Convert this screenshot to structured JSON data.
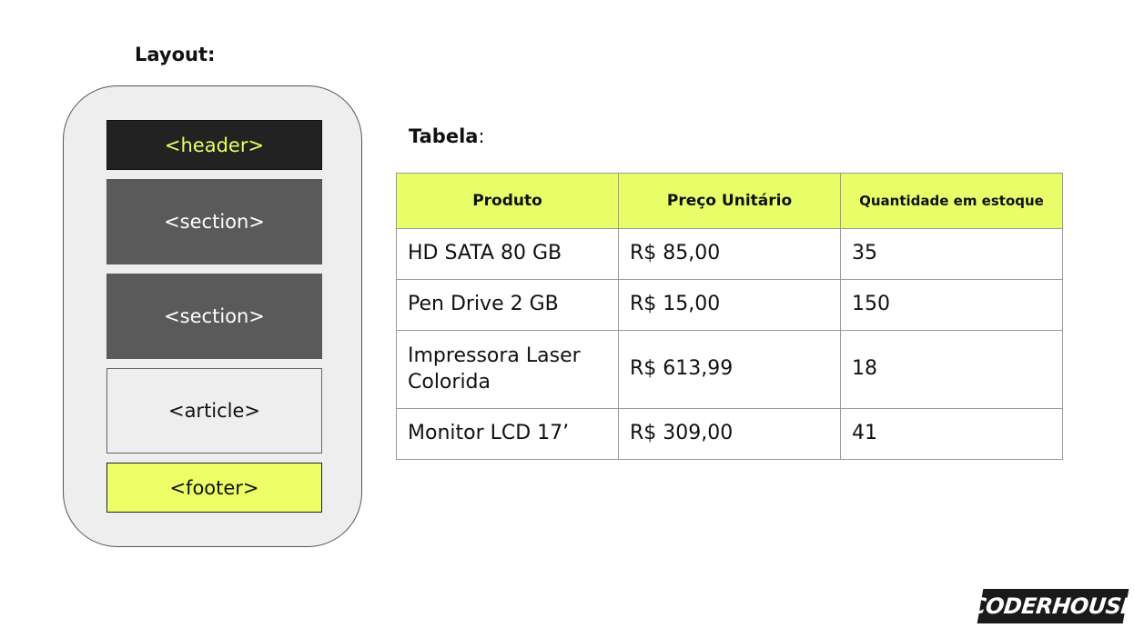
{
  "layout": {
    "title": "Layout:",
    "blocks": [
      "<header>",
      "<section>",
      "<section>",
      "<article>",
      "<footer>"
    ]
  },
  "tabela": {
    "label": "Tabela",
    "suffix": ":",
    "headers": [
      "Produto",
      "Preço Unitário",
      "Quantidade em estoque"
    ],
    "rows": [
      [
        "HD SATA 80 GB",
        "R$ 85,00",
        "35"
      ],
      [
        "Pen Drive 2 GB",
        "R$ 15,00",
        "150"
      ],
      [
        "Impressora Laser Colorida",
        "R$ 613,99",
        "18"
      ],
      [
        "Monitor LCD 17’",
        "R$ 309,00",
        "41"
      ]
    ]
  },
  "brand": {
    "logo_text": "CODERHOUSE"
  },
  "colors": {
    "accent_yellow": "#e8ff6a",
    "dark_header": "#222222",
    "section_gray": "#5a5a5a"
  }
}
